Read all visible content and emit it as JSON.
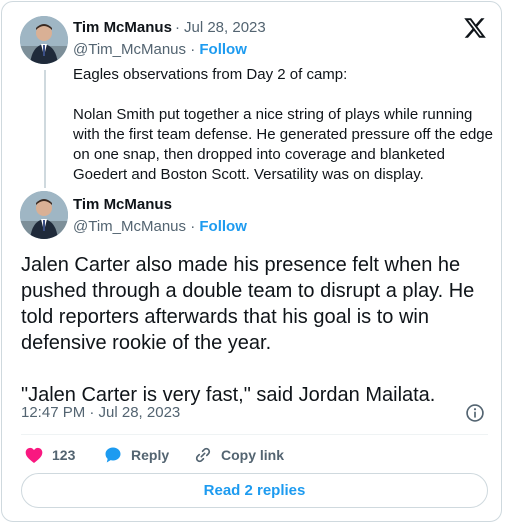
{
  "quoted": {
    "author_name": "Tim McManus",
    "date": "Jul 28, 2023",
    "handle": "@Tim_McManus",
    "follow_label": "Follow",
    "paragraphs": [
      "Eagles observations from Day 2 of camp:",
      "Nolan Smith put together a nice string of plays while running with the first team defense. He generated pressure off the edge on one snap, then dropped into coverage and blanketed Goedert and Boston Scott. Versatility was on display."
    ]
  },
  "tweet": {
    "author_name": "Tim McManus",
    "handle": "@Tim_McManus",
    "follow_label": "Follow",
    "paragraphs": [
      "Jalen Carter also made his presence felt when he pushed through a double team to disrupt a play. He told reporters afterwards that his goal is to win defensive rookie of the year.",
      "\"Jalen Carter is very fast,\" said Jordan Mailata."
    ],
    "timestamp": "12:47 PM · Jul 28, 2023"
  },
  "actions": {
    "like_count": "123",
    "reply_label": "Reply",
    "copy_label": "Copy link"
  },
  "read_replies_label": "Read 2 replies",
  "icons": {
    "logo": "x-logo-icon",
    "info": "info-icon",
    "like": "heart-icon",
    "reply": "speech-bubble-icon",
    "copy": "link-icon"
  },
  "colors": {
    "accent": "#1d9bf0",
    "like": "#f91880",
    "secondary_text": "#536471",
    "border": "#cfd9de"
  }
}
